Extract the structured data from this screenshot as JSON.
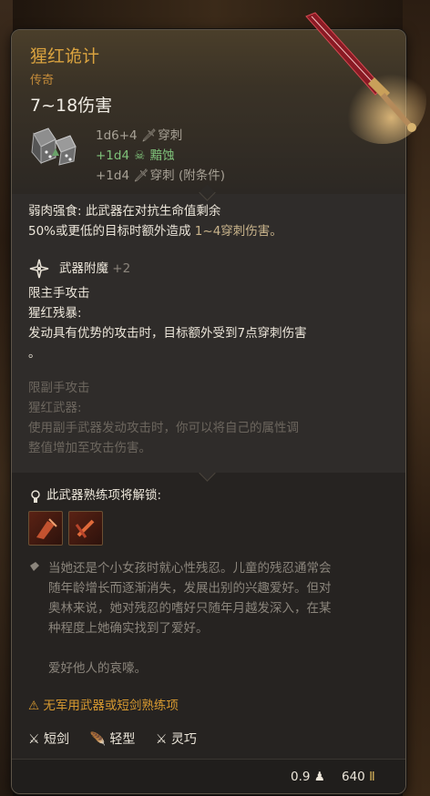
{
  "item": {
    "name": "猩红诡计",
    "rarity": "传奇",
    "damage_range": "7~18伤害",
    "damage_lines": [
      {
        "dice": "1d6+4",
        "type": "穿刺"
      },
      {
        "dice": "+1d4",
        "type": "黯蚀"
      },
      {
        "dice": "+1d4",
        "type": "穿刺 (附条件)"
      }
    ]
  },
  "passive": {
    "line1": "弱肉强食: 此武器在对抗生命值剩余",
    "line2_a": "50%或更低的目标时额外造成 ",
    "line2_b": "1~4穿刺伤害。"
  },
  "enchant": {
    "label": "武器附魔",
    "value": "+2"
  },
  "main_hand": {
    "restriction": "限主手攻击",
    "title": "猩红残暴:",
    "desc1": "发动具有优势的攻击时，目标额外受到7点穿刺伤害",
    "desc2": "。"
  },
  "off_hand": {
    "restriction": "限副手攻击",
    "title": "猩红武器:",
    "desc1": "使用副手武器发动攻击时，你可以将自己的属性调",
    "desc2": "整值增加至攻击伤害。"
  },
  "proficiency": {
    "header": "此武器熟练项将解锁:",
    "icons": [
      "proficiency-action-1-icon",
      "proficiency-action-2-icon"
    ]
  },
  "lore": {
    "lines": [
      "当她还是个小女孩时就心性残忍。儿童的残忍通常会",
      "随年龄增长而逐渐消失，发展出别的兴趣爱好。但对",
      "奥林来说，她对残忍的嗜好只随年月越发深入，在某",
      "种程度上她确实找到了爱好。",
      "",
      "爱好他人的哀嚎。"
    ]
  },
  "warning": "无军用武器或短剑熟练项",
  "tags": [
    {
      "label": "短剑",
      "icon": "short-sword-icon"
    },
    {
      "label": "轻型",
      "icon": "light-feather-icon"
    },
    {
      "label": "灵巧",
      "icon": "finesse-icon"
    }
  ],
  "footer": {
    "weight": "0.9",
    "price": "640"
  },
  "colors": {
    "title": "#d9a23f",
    "necrotic": "#7fc27a",
    "warning": "#d89a30"
  }
}
